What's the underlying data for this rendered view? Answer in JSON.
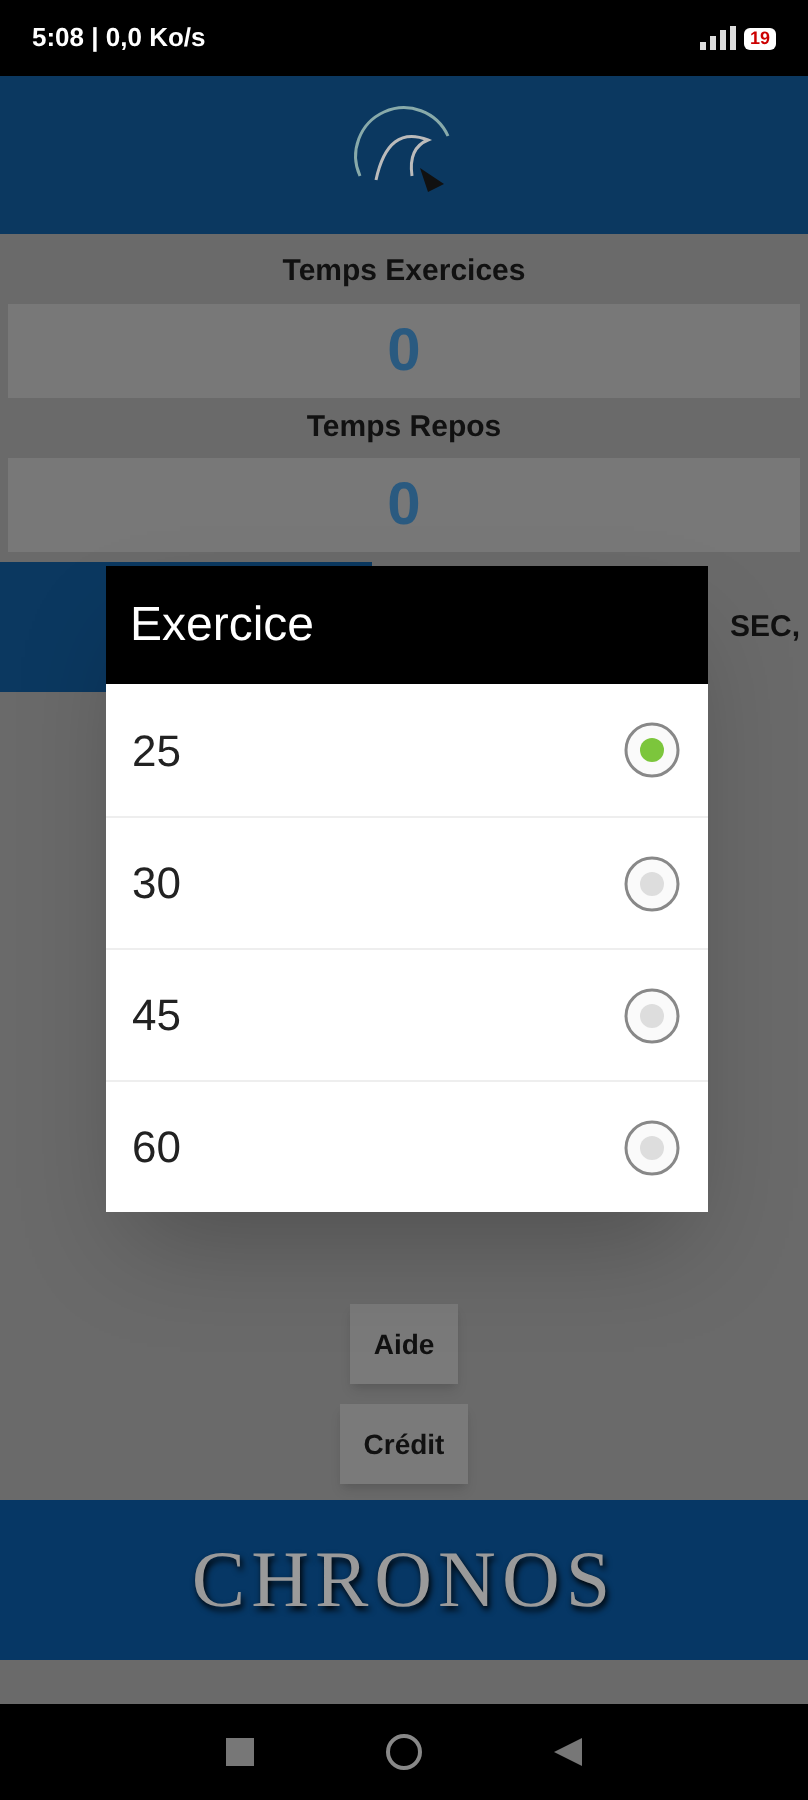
{
  "status_bar": {
    "text": "5:08 | 0,0 Ko/s",
    "battery": "19"
  },
  "timers": [
    {
      "label": "Temps Exercices",
      "value": "0"
    },
    {
      "label": "Temps Repos",
      "value": "0"
    }
  ],
  "info_text": "SEC,",
  "dialog": {
    "title": "Exercice",
    "options": [
      {
        "label": "25",
        "selected": true
      },
      {
        "label": "30",
        "selected": false
      },
      {
        "label": "45",
        "selected": false
      },
      {
        "label": "60",
        "selected": false
      }
    ]
  },
  "buttons": [
    "Aide",
    "Crédit"
  ],
  "banner": "CHRONOS"
}
